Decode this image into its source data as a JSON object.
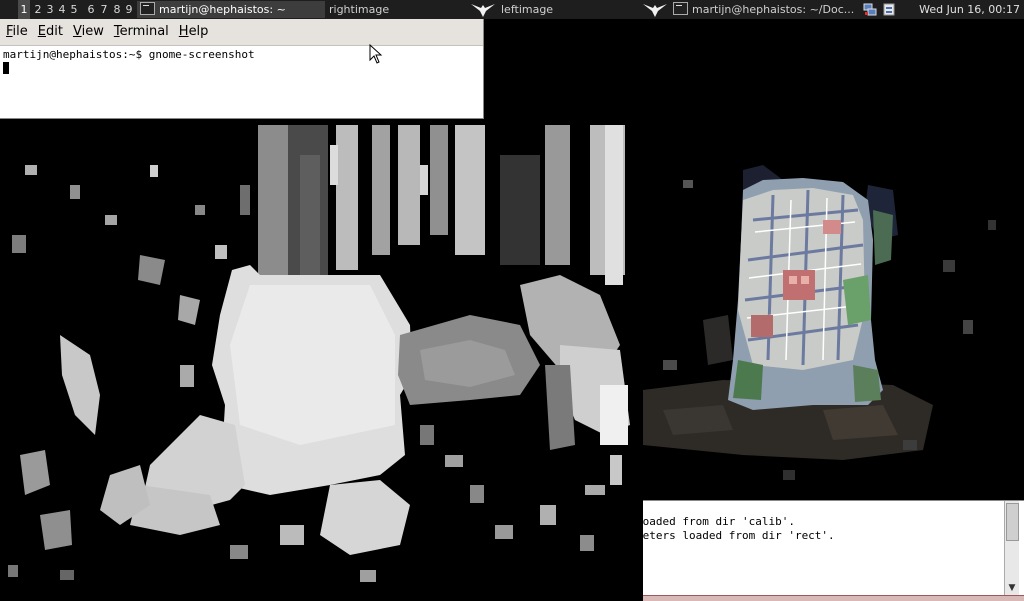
{
  "panel": {
    "workspaces": [
      "1",
      "2",
      "3",
      "4",
      "5",
      "6",
      "7",
      "8",
      "9"
    ],
    "active_workspace": "1",
    "tasks": [
      {
        "label": "martijn@hephaistos: ~",
        "icon": "terminal-icon",
        "active": true
      },
      {
        "label": "rightimage",
        "icon": "",
        "active": false
      },
      {
        "label": "leftimage",
        "icon": "bird-icon",
        "active": false
      },
      {
        "label": "martijn@hephaistos: ~/Doc...",
        "icon": "terminal-icon",
        "active": false
      }
    ],
    "clock": "Wed Jun 16, 00:17"
  },
  "terminal": {
    "menu": [
      "File",
      "Edit",
      "View",
      "Terminal",
      "Help"
    ],
    "prompt_line": "martijn@hephaistos:~$ gnome-screenshot"
  },
  "console": {
    "lines": [
      "loaded from dir 'calib'.",
      "neters loaded from dir 'rect'.",
      "",
      "."
    ]
  },
  "colors": {
    "panel_bg": "#1e1e1e",
    "menubar_bg": "#e6e3de",
    "desktop_bg": "#000000"
  }
}
